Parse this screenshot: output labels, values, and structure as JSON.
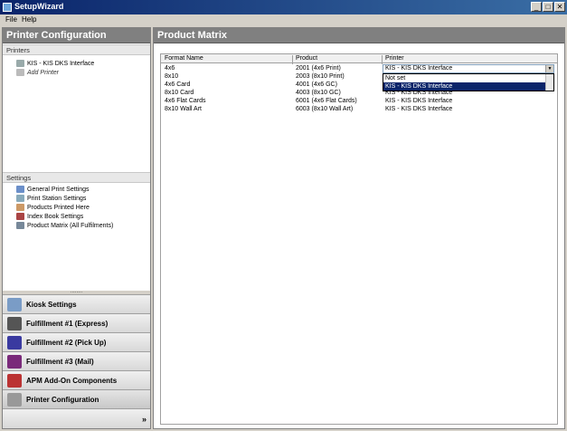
{
  "window": {
    "title": "SetupWizard",
    "min": "_",
    "max": "□",
    "close": "✕"
  },
  "menu": [
    "File",
    "Help"
  ],
  "left": {
    "header": "Printer Configuration",
    "printers_title": "Printers",
    "printers": [
      "KIS - KIS DKS Interface",
      "Add Printer"
    ],
    "settings_title": "Settings",
    "settings": [
      "General Print Settings",
      "Print Station Settings",
      "Products Printed Here",
      "Index Book Settings",
      "Product Matrix (All Fulfilments)"
    ],
    "splitter": "........",
    "nav": [
      "Kiosk Settings",
      "Fulfillment #1 (Express)",
      "Fulfillment #2 (Pick Up)",
      "Fulfillment #3 (Mail)",
      "APM Add-On Components",
      "Printer Configuration"
    ],
    "footer_chevron": "»"
  },
  "right": {
    "header": "Product Matrix",
    "columns": [
      "Format Name",
      "Product",
      "Printer"
    ],
    "rows": [
      [
        "4x6",
        "2001 (4x6 Print)",
        "KIS - KIS DKS Interface"
      ],
      [
        "8x10",
        "2003 (8x10 Print)",
        ""
      ],
      [
        "4x6 Card",
        "4001 (4x6 GC)",
        ""
      ],
      [
        "8x10 Card",
        "4003 (8x10 GC)",
        "KIS - KIS DKS Interface"
      ],
      [
        "4x6 Flat Cards",
        "6001 (4x6 Flat Cards)",
        "KIS - KIS DKS Interface"
      ],
      [
        "8x10 Wall Art",
        "6003 (8x10 Wall Art)",
        "KIS - KIS DKS Interface"
      ]
    ],
    "combo_value": "KIS - KIS DKS Interface",
    "dropdown_options": [
      "Not set",
      "KIS - KIS DKS Interface"
    ]
  },
  "colors": {
    "title_bar": "#0a246a",
    "pane_header": "#808080",
    "selection": "#0a246a"
  }
}
